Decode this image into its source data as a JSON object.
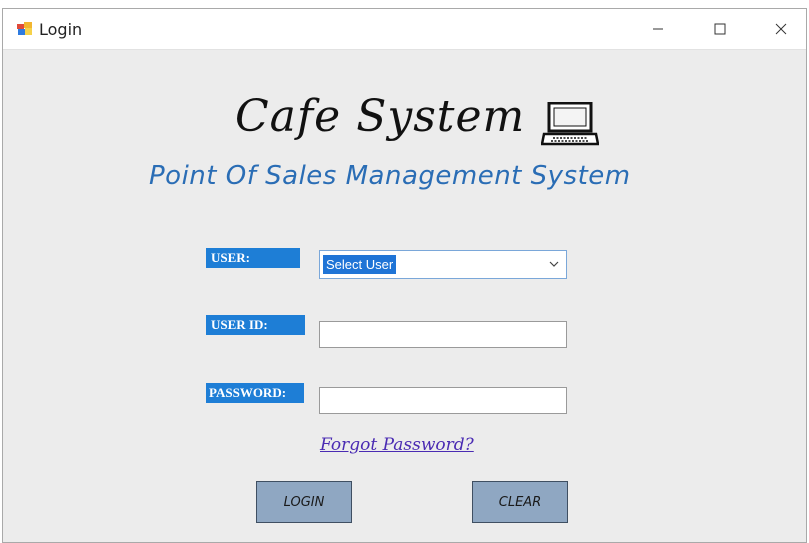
{
  "window": {
    "title": "Login",
    "controls": [
      "minimize-icon",
      "maximize-icon",
      "close-icon"
    ]
  },
  "app": {
    "title": "Cafe System",
    "subtitle": "Point Of Sales Management System",
    "logo_icon": "laptop-icon"
  },
  "form": {
    "user_label": "USER:",
    "user_select_value": "Select User",
    "user_id_label": "USER ID:",
    "user_id_value": "",
    "password_label": "PASSWORD:",
    "password_value": "",
    "forgot_password_text": "Forgot Password?"
  },
  "buttons": {
    "login_label": "LOGIN",
    "clear_label": "CLEAR"
  },
  "colors": {
    "label_bg": "#1e7ed6",
    "subtitle": "#2a6db5",
    "button_bg": "#8fa7c2",
    "link": "#4a2bb3"
  }
}
